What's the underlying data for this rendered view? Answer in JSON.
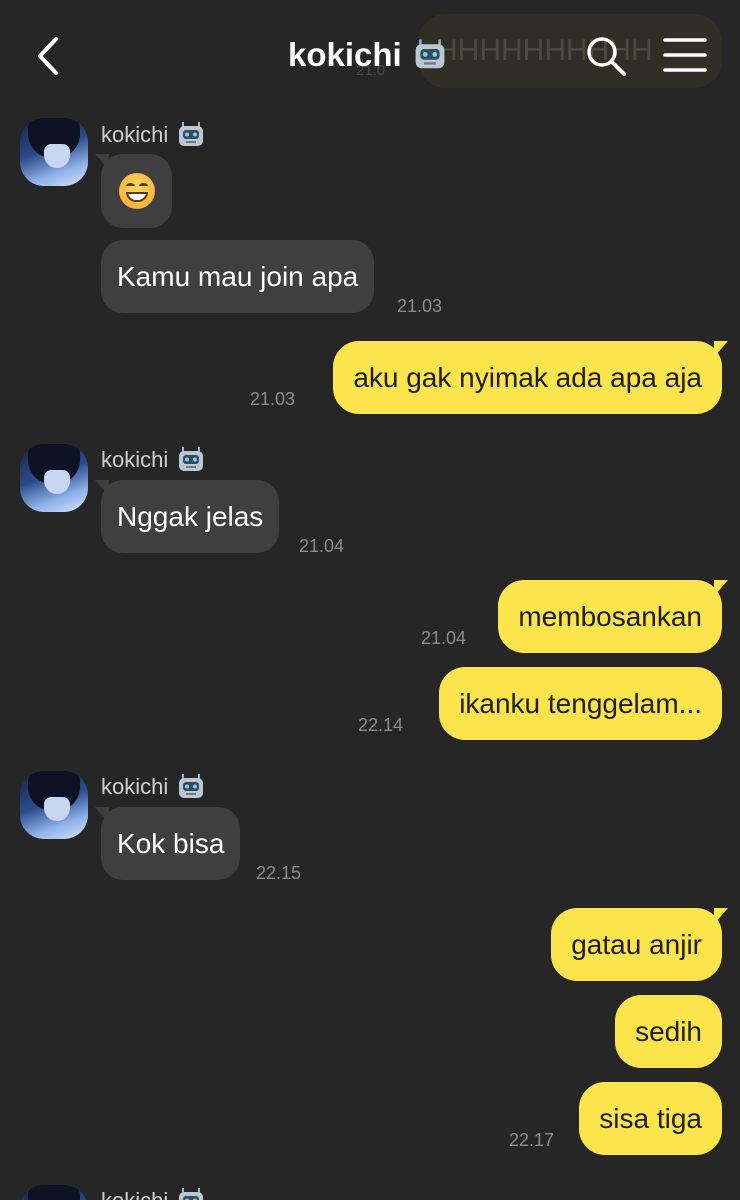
{
  "header": {
    "title": "kokichi",
    "title_badge": "robot-icon",
    "background_bubble_text": "HHHHHHHHHH",
    "background_bubble_time": "21.0"
  },
  "colors": {
    "background": "#262626",
    "incoming_bubble": "#3f3f3f",
    "outgoing_bubble": "#fbe44c",
    "timestamp": "#8c8c8c"
  },
  "messages": {
    "g1": {
      "sender": "kokichi",
      "emoji": "grinning-face-with-smiling-eyes",
      "text": "Kamu mau join apa",
      "time": "21.03"
    },
    "o1": {
      "text": "aku gak nyimak ada apa aja",
      "time": "21.03"
    },
    "g2": {
      "sender": "kokichi",
      "text": "Nggak jelas",
      "time": "21.04"
    },
    "o2": {
      "text": "membosankan",
      "time": "21.04"
    },
    "o3": {
      "text": "ikanku tenggelam...",
      "time": "22.14"
    },
    "g3": {
      "sender": "kokichi",
      "text": "Kok bisa",
      "time": "22.15"
    },
    "o4": {
      "text": "gatau anjir"
    },
    "o5": {
      "text": "sedih"
    },
    "o6": {
      "text": "sisa tiga",
      "time": "22.17"
    },
    "g4": {
      "sender": "kokichi"
    }
  }
}
